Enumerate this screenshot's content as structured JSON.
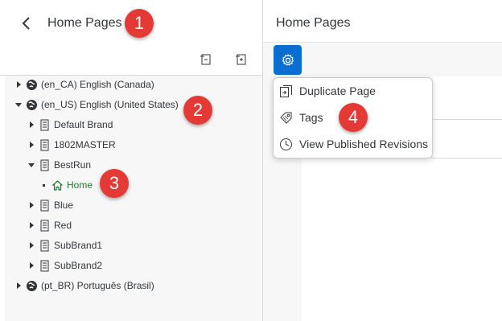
{
  "left_panel": {
    "title": "Home Pages",
    "tree": [
      {
        "label": "(en_CA) English (Canada)",
        "type": "locale",
        "expanded": false
      },
      {
        "label": "(en_US) English (United States)",
        "type": "locale",
        "expanded": true
      },
      {
        "label": "Default Brand",
        "type": "brand",
        "expanded": false
      },
      {
        "label": "1802MASTER",
        "type": "brand",
        "expanded": false
      },
      {
        "label": "BestRun",
        "type": "brand",
        "expanded": true
      },
      {
        "label": "Home",
        "type": "page",
        "selected": true
      },
      {
        "label": "Blue",
        "type": "brand",
        "expanded": false
      },
      {
        "label": "Red",
        "type": "brand",
        "expanded": false
      },
      {
        "label": "SubBrand1",
        "type": "brand",
        "expanded": false
      },
      {
        "label": "SubBrand2",
        "type": "brand",
        "expanded": false
      },
      {
        "label": "(pt_BR) Português (Brasil)",
        "type": "locale",
        "expanded": false
      }
    ]
  },
  "right_panel": {
    "title": "Home Pages"
  },
  "menu": {
    "items": [
      {
        "label": "Duplicate Page",
        "icon": "duplicate-icon"
      },
      {
        "label": "Tags",
        "icon": "tag-icon"
      },
      {
        "label": "View Published Revisions",
        "icon": "clock-icon"
      }
    ]
  },
  "callouts": [
    "1",
    "2",
    "3",
    "4"
  ],
  "colors": {
    "accent": "#0a6ed1",
    "callout": "#e53935",
    "selected_text": "#1d7a2a"
  }
}
